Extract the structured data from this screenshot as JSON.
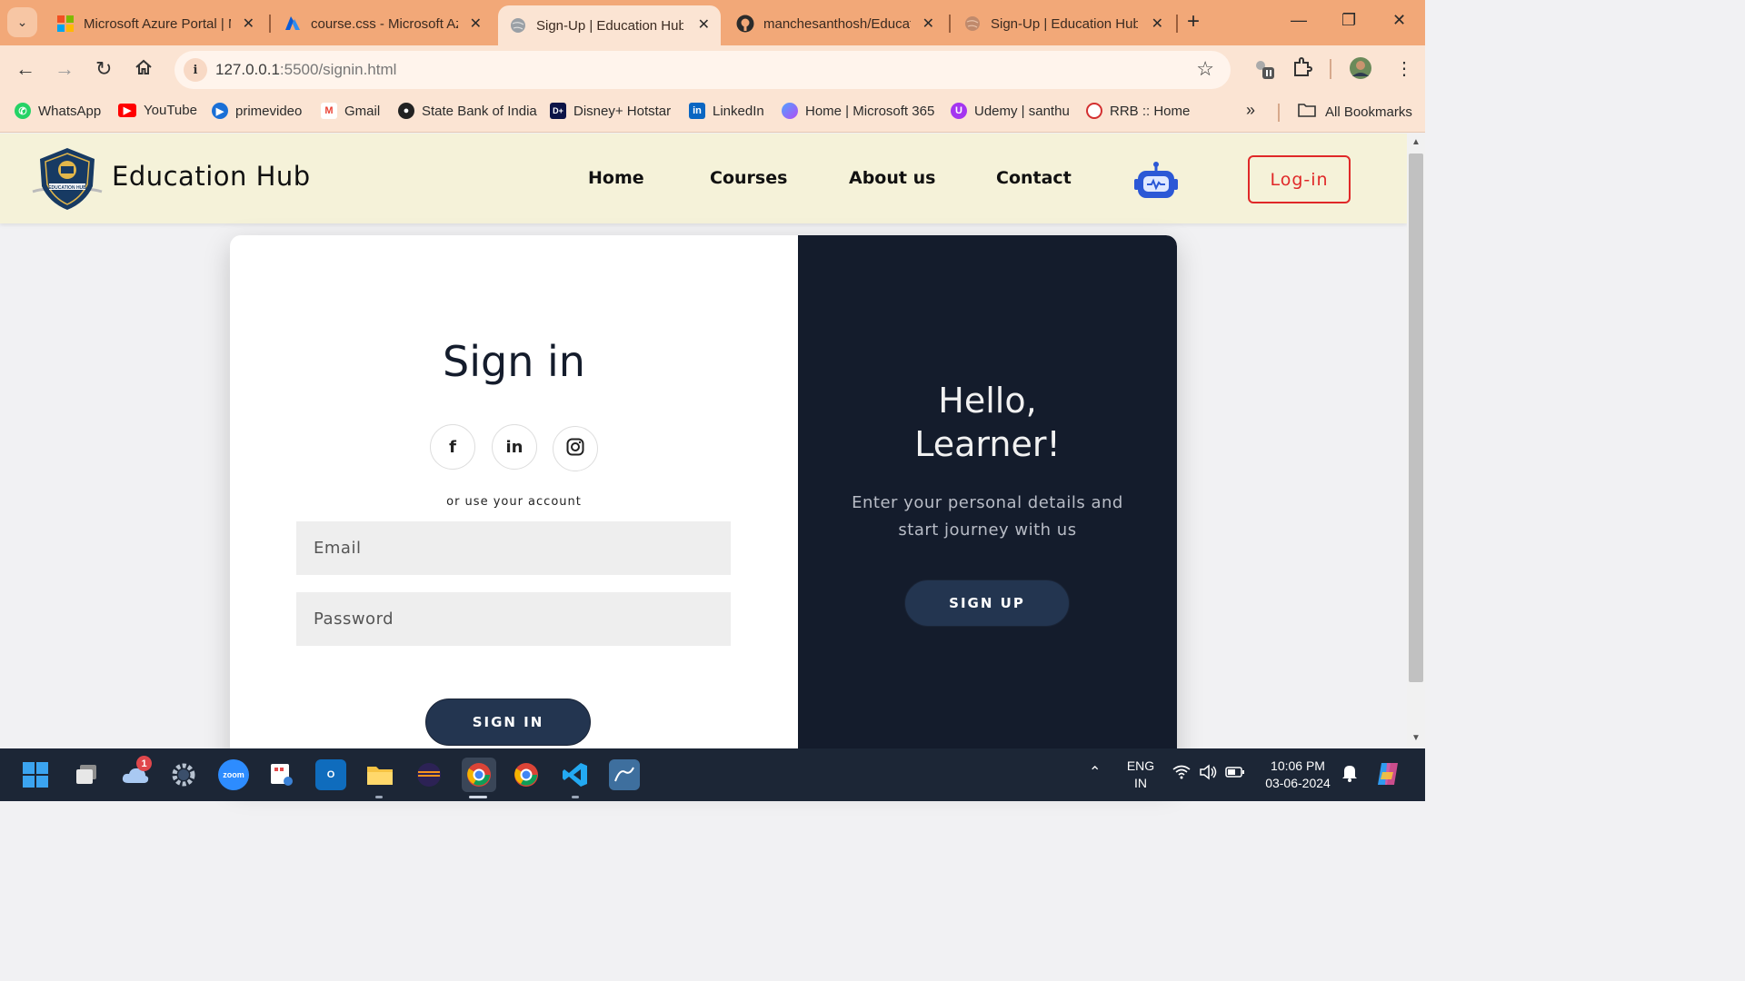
{
  "browser": {
    "tabs": [
      {
        "title": "Microsoft Azure Portal | M",
        "icon": "microsoft-icon",
        "active": false
      },
      {
        "title": "course.css - Microsoft Az",
        "icon": "azure-icon",
        "active": false
      },
      {
        "title": "Sign-Up | Education Hub",
        "icon": "globe-icon",
        "active": true
      },
      {
        "title": "manchesanthosh/Educati",
        "icon": "github-icon",
        "active": false
      },
      {
        "title": "Sign-Up | Education Hub",
        "icon": "globe-icon",
        "active": false
      }
    ],
    "url_host": "127.0.0.1",
    "url_rest": ":5500/signin.html",
    "bookmarks": [
      {
        "label": "WhatsApp",
        "icon": "whatsapp-icon",
        "color": "#25d366"
      },
      {
        "label": "YouTube",
        "icon": "youtube-icon",
        "color": "#ff0000"
      },
      {
        "label": "primevideo",
        "icon": "primevideo-icon",
        "color": "#1a98ff"
      },
      {
        "label": "Gmail",
        "icon": "gmail-icon",
        "color": "#ea4335"
      },
      {
        "label": "State Bank of India",
        "icon": "sbi-icon",
        "color": "#222222"
      },
      {
        "label": "Disney+ Hotstar",
        "icon": "hotstar-icon",
        "color": "#0c1447"
      },
      {
        "label": "LinkedIn",
        "icon": "linkedin-icon",
        "color": "#0a66c2"
      },
      {
        "label": "Home | Microsoft 365",
        "icon": "m365-icon",
        "color": "#7a5cff"
      },
      {
        "label": "Udemy | santhu",
        "icon": "udemy-icon",
        "color": "#a435f0"
      },
      {
        "label": "RRB :: Home",
        "icon": "rrb-icon",
        "color": "#d32f2f"
      }
    ],
    "all_bookmarks": "All Bookmarks"
  },
  "site": {
    "brand": "Education Hub",
    "logo_text": "EDUCATION HUB",
    "nav": [
      "Home",
      "Courses",
      "About us",
      "Contact"
    ],
    "login": "Log-in"
  },
  "signin": {
    "title": "Sign in",
    "social": [
      {
        "icon": "facebook-icon",
        "glyph": "f"
      },
      {
        "icon": "linkedin-icon",
        "glyph": "in"
      },
      {
        "icon": "instagram-icon",
        "glyph": ""
      }
    ],
    "or_text": "or use your account",
    "email_placeholder": "Email",
    "password_placeholder": "Password",
    "button": "SIGN IN"
  },
  "signup_panel": {
    "title_line1": "Hello,",
    "title_line2": "Learner!",
    "subtitle": "Enter your personal details and start journey with us",
    "button": "SIGN UP"
  },
  "taskbar": {
    "notification_badge": "1",
    "lang_line1": "ENG",
    "lang_line2": "IN",
    "time": "10:06 PM",
    "date": "03-06-2024",
    "zoom_label": "zoom"
  }
}
